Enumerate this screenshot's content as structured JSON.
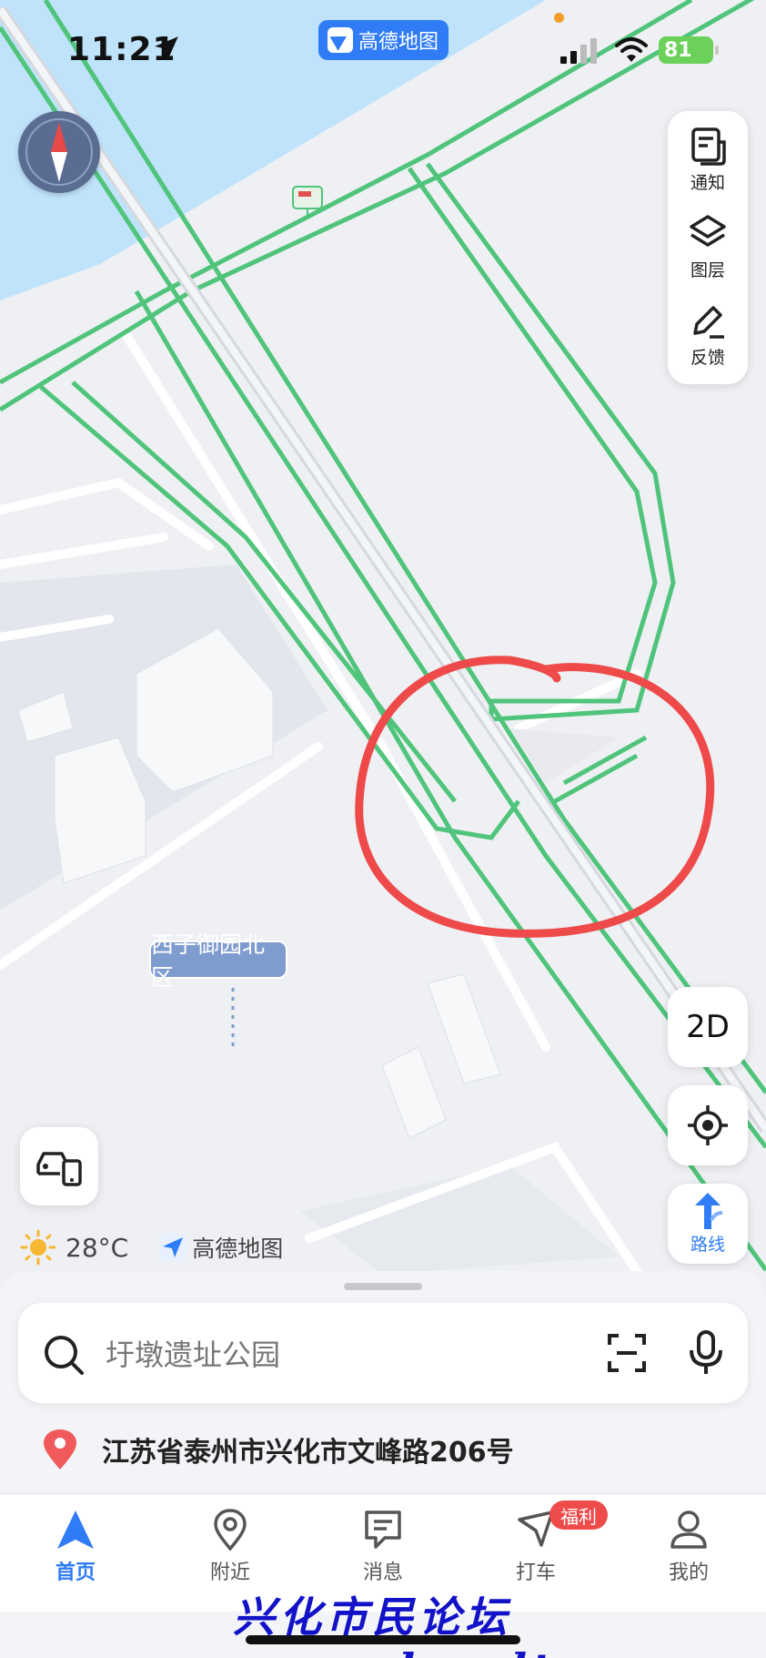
{
  "status_bar": {
    "time": "11:21",
    "battery": "81"
  },
  "app_badge": "高德地图",
  "toolbar": {
    "notice": "通知",
    "layers": "图层",
    "feedback": "反馈"
  },
  "map": {
    "view_mode": "2D",
    "route_label": "路线",
    "poi_label": "西子御园北区",
    "weather_temp": "28°C",
    "brand": "高德地图"
  },
  "search": {
    "placeholder": "圩墩遗址公园"
  },
  "current_address": "江苏省泰州市兴化市文峰路206号",
  "tabs": [
    {
      "label": "首页",
      "icon": "home-navigation-icon",
      "active": true
    },
    {
      "label": "附近",
      "icon": "nearby-pin-icon",
      "active": false
    },
    {
      "label": "消息",
      "icon": "message-icon",
      "active": false
    },
    {
      "label": "打车",
      "icon": "taxi-icon",
      "active": false
    },
    {
      "label": "我的",
      "icon": "profile-icon",
      "active": false
    }
  ],
  "taxi_badge": "福利",
  "watermark": "兴化市民论坛 www.xhsmlt.com",
  "colors": {
    "accent": "#2f7cf6",
    "road_edge": "#4fc47a",
    "water": "#bfe3fb",
    "annotation_circle": "#ee4a4a",
    "battery": "#6bd15a"
  }
}
